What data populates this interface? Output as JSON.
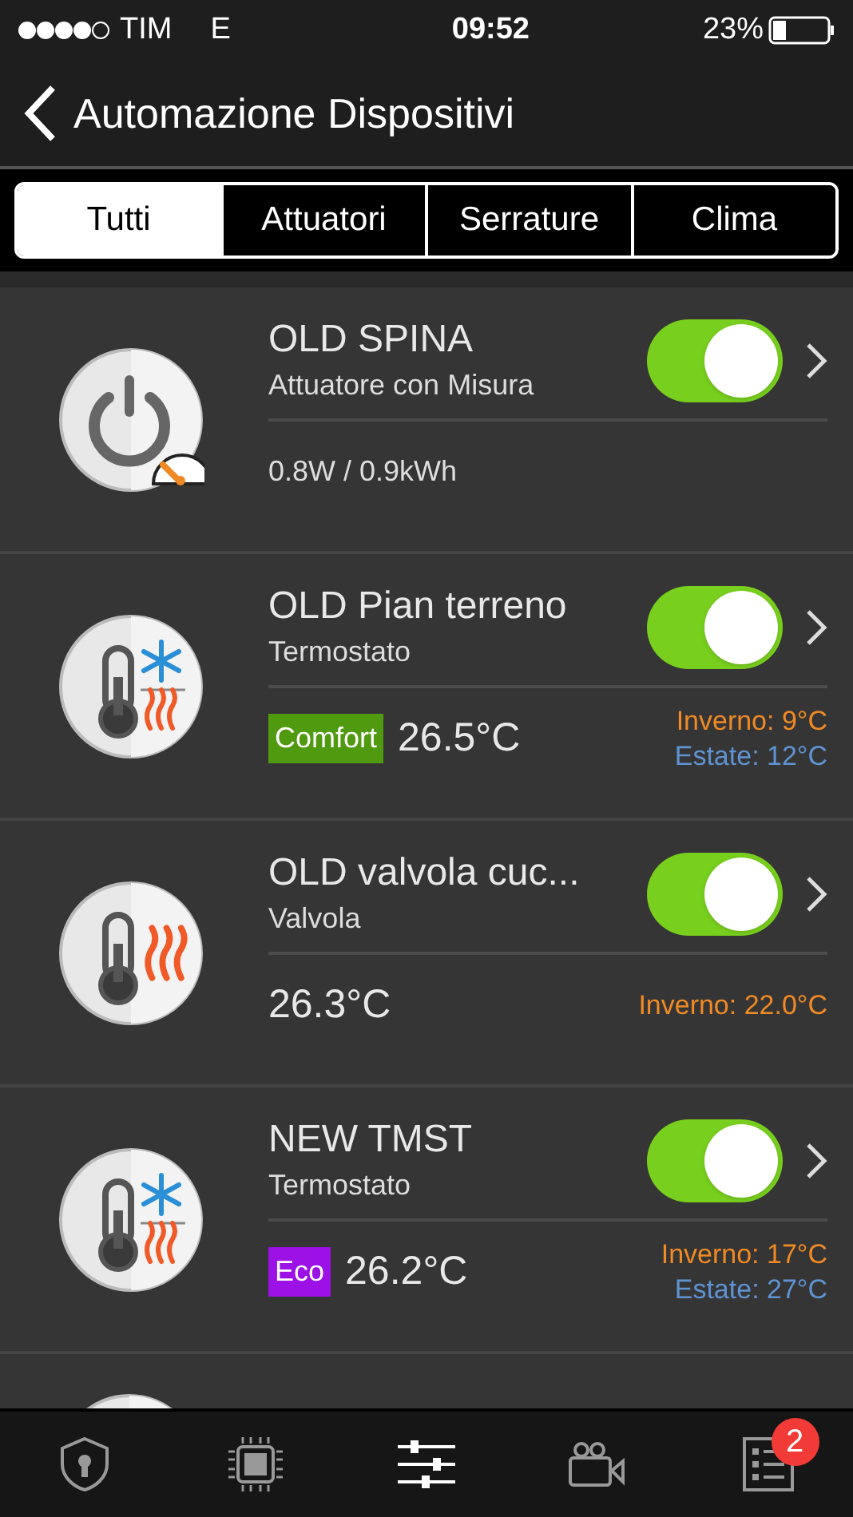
{
  "status_bar": {
    "carrier": "TIM",
    "network": "E",
    "time": "09:52",
    "battery": "23%"
  },
  "nav": {
    "title": "Automazione Dispositivi"
  },
  "tabs": [
    {
      "label": "Tutti",
      "selected": true
    },
    {
      "label": "Attuatori",
      "selected": false
    },
    {
      "label": "Serrature",
      "selected": false
    },
    {
      "label": "Clima",
      "selected": false
    }
  ],
  "devices": [
    {
      "kind": "meter",
      "name": "OLD SPINA",
      "type": "Attuatore con Misura",
      "on": true,
      "reading": "0.8W / 0.9kWh"
    },
    {
      "kind": "thermostat",
      "name": "OLD Pian terreno",
      "type": "Termostato",
      "on": true,
      "mode": {
        "label": "Comfort",
        "color": "#4f9a0f"
      },
      "temperature": "26.5°C",
      "winter": "Inverno: 9°C",
      "summer": "Estate: 12°C"
    },
    {
      "kind": "valve",
      "name": "OLD valvola cuc...",
      "type": "Valvola",
      "on": true,
      "temperature": "26.3°C",
      "winter": "Inverno: 22.0°C"
    },
    {
      "kind": "thermostat",
      "name": "NEW TMST",
      "type": "Termostato",
      "on": true,
      "mode": {
        "label": "Eco",
        "color": "#9b11e6"
      },
      "temperature": "26.2°C",
      "winter": "Inverno: 17°C",
      "summer": "Estate: 27°C"
    }
  ],
  "bottom_tabs": [
    {
      "kind": "security",
      "selected": false
    },
    {
      "kind": "devices",
      "selected": false
    },
    {
      "kind": "automation",
      "selected": true
    },
    {
      "kind": "cameras",
      "selected": false
    },
    {
      "kind": "events",
      "selected": false,
      "badge": "2"
    }
  ]
}
